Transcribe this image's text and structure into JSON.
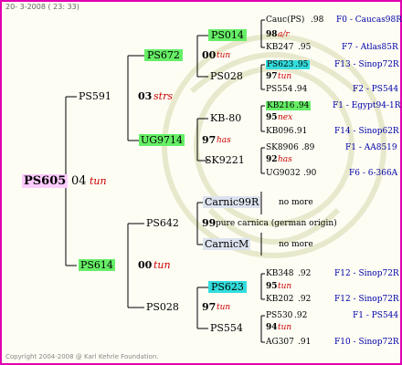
{
  "header_date": "20- 3-2008 ( 23: 33)",
  "footer": "Copyright 2004-2008 @ Karl Kehrle Foundation.",
  "root": {
    "id": "PS605",
    "sep": "04",
    "line": "tun"
  },
  "g1": [
    {
      "id": "PS591",
      "sep": "03",
      "line": "strs"
    },
    {
      "id": "PS614",
      "sep": "00",
      "line": "tun"
    }
  ],
  "g2": [
    {
      "id": "PS672",
      "sep": "00",
      "line": "tun"
    },
    {
      "id": "UG9714",
      "sep": "97",
      "line": "has"
    },
    {
      "id": "PS642",
      "sep": "99",
      "line": "pure carnica (german origin)"
    },
    {
      "id": "PS028",
      "sep": "97",
      "line": "tun"
    }
  ],
  "g3": [
    {
      "id": "PS014",
      "sep": "98",
      "line": "a/r"
    },
    {
      "id": "PS028",
      "sep": "97",
      "line": "tun"
    },
    {
      "id": "KB-80",
      "sep": "95",
      "line": "nex"
    },
    {
      "id": "SK9221",
      "sep": "92",
      "line": "has"
    },
    {
      "id": "Carnic99R",
      "note": "no more"
    },
    {
      "id": "CarnicM",
      "note": "no more"
    },
    {
      "id": "PS623",
      "sep": "95",
      "line": "tun"
    },
    {
      "id": "PS554",
      "sep": "94",
      "line": "tun"
    }
  ],
  "g4": [
    {
      "id": "Cauc(PS)",
      "yr": ".98",
      "src": "F0 - Caucas98R"
    },
    {
      "id": "KB247",
      "yr": ".95",
      "src": "F7 - Atlas85R"
    },
    {
      "id": "PS623",
      "yr": ".95",
      "src": "F13 - Sinop72R"
    },
    {
      "id": "PS554",
      "yr": ".94",
      "src": "F2 - PS544"
    },
    {
      "id": "KB216",
      "yr": ".94",
      "src": "F1 - Egypt94-1R"
    },
    {
      "id": "KB096",
      "yr": ".91",
      "src": "F14 - Sinop62R"
    },
    {
      "id": "SK8906",
      "yr": ".89",
      "src": "F1 - AA8519"
    },
    {
      "id": "UG9032",
      "yr": ".90",
      "src": "F6 - 6-366A"
    },
    {
      "id": "KB348",
      "yr": ".92",
      "src": "F12 - Sinop72R"
    },
    {
      "id": "KB202",
      "yr": ".92",
      "src": "F12 - Sinop72R"
    },
    {
      "id": "PS530",
      "yr": ".92",
      "src": "F1 - PS544"
    },
    {
      "id": "AG307",
      "yr": ".91",
      "src": "F10 - Sinop72R"
    }
  ],
  "colors": {
    "frame": "#e000b0",
    "green": "#66ee66",
    "cyan": "#33dddd",
    "pink": "#ffccff",
    "red": "#cc0000",
    "blue": "#0000aa"
  }
}
